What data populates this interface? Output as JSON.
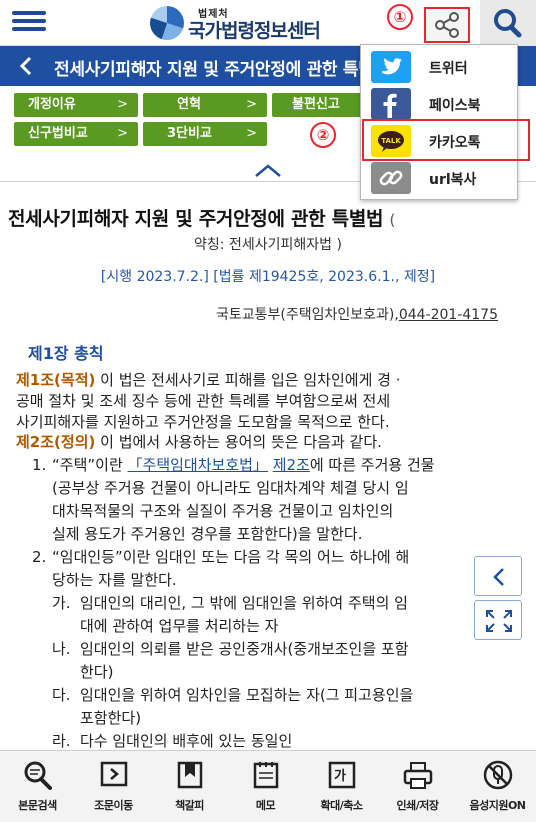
{
  "header": {
    "logo_small": "법제처",
    "logo_main": "국가법령정보센터",
    "menu_icon": "hamburger-menu-icon",
    "share_icon": "share-icon",
    "search_icon": "search-icon",
    "callout_1": "①",
    "callout_2": "②",
    "accent_color": "#e8262d"
  },
  "titlebar": {
    "title": "전세사기피해자 지원 및 주거안정에 관한 특별법",
    "background": "#1f4fa0"
  },
  "tabs": [
    {
      "label": "개정이유"
    },
    {
      "label": "연혁"
    },
    {
      "label": "불편신고"
    },
    {
      "label": "신구법비교"
    },
    {
      "label": "3단비교"
    }
  ],
  "tab_chevron": ">",
  "share_menu": {
    "items": [
      {
        "label": "트위터",
        "icon": "twitter-icon"
      },
      {
        "label": "페이스북",
        "icon": "facebook-icon"
      },
      {
        "label": "카카오톡",
        "icon": "kakaotalk-icon",
        "icon_text": "TALK"
      },
      {
        "label": "url복사",
        "icon": "link-icon"
      }
    ]
  },
  "law": {
    "title": "전세사기피해자 지원 및 주거안정에 관한 특별법",
    "title_suffix": "(",
    "abbreviation": "약칭: 전세사기피해자법 )",
    "enactment": "[시행 2023.7.2.] [법률 제19425호, 2023.6.1., 제정]",
    "ministry": "국토교통부(주택임차인보호과),",
    "phone": "044-201-4175",
    "chapter": "제1장 총칙",
    "article1_title": "제1조(목적)",
    "article1_lines": [
      " 이 법은 전세사기로 피해를 입은 임차인에게 경 ·",
      "공매 절차 및 조세 징수 등에 관한 특례를 부여함으로써 전세",
      "사기피해자를 지원하고 주거안정을 도모함을 목적으로 한다."
    ],
    "article2_title": "제2조(정의)",
    "article2_intro": " 이 법에서 사용하는 용어의 뜻은 다음과 같다.",
    "item1_num": "1.",
    "item1_pre": "“주택”이란 ",
    "item1_link1": "「주택임대차보호법」",
    "item1_mid": " ",
    "item1_link2": "제2조",
    "item1_post": "에 따른 주거용 건물",
    "item1_lines": [
      "(공부상 주거용 건물이 아니라도 임대차계약 체결 당시 임",
      "대차목적물의 구조와 실질이 주거용 건물이고 임차인의",
      "실제 용도가 주거용인 경우를 포함한다)을 말한다."
    ],
    "item2_num": "2.",
    "item2_lines": [
      "“임대인등”이란 임대인 또는 다음 각 목의 어느 하나에 해",
      "당하는 자를 말한다."
    ],
    "subitems": [
      {
        "mark": "가.",
        "lines": [
          "임대인의 대리인, 그 밖에 임대인을 위하여 주택의 임",
          "대에 관하여 업무를 처리하는 자"
        ]
      },
      {
        "mark": "나.",
        "lines": [
          "임대인의 의뢰를 받은 공인중개사(중개보조인을 포함",
          "한다)"
        ]
      },
      {
        "mark": "다.",
        "lines": [
          "임대인을 위하여 임차인을 모집하는 자(그 피고용인을",
          "포함한다)"
        ]
      },
      {
        "mark": "라.",
        "lines": [
          "다수 임대인의 배후에 있는 동일인"
        ]
      }
    ]
  },
  "floating": {
    "prev_icon": "chevron-left-icon",
    "expand_icon": "expand-icon"
  },
  "toolbar": {
    "items": [
      {
        "label": "본문검색",
        "icon": "search-text-icon"
      },
      {
        "label": "조문이동",
        "icon": "move-article-icon"
      },
      {
        "label": "책갈피",
        "icon": "bookmark-icon"
      },
      {
        "label": "메모",
        "icon": "memo-icon"
      },
      {
        "label": "확대/축소",
        "icon": "zoom-text-icon",
        "icon_text": "가"
      },
      {
        "label": "인쇄/저장",
        "icon": "print-icon"
      },
      {
        "label": "음성지원ON",
        "icon": "voice-mute-icon"
      }
    ]
  }
}
